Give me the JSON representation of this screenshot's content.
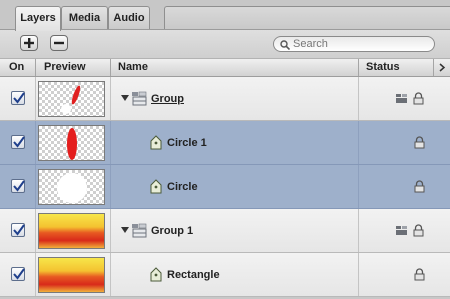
{
  "tabs": [
    "Layers",
    "Media",
    "Audio"
  ],
  "toolbar": {
    "add_icon": "plus-icon",
    "remove_icon": "minus-icon",
    "search_placeholder": "Search"
  },
  "columns": {
    "on": "On",
    "preview": "Preview",
    "name": "Name",
    "status": "Status"
  },
  "rows": [
    {
      "name": "Group",
      "kind": "group",
      "checked": true,
      "selected": false,
      "expanded": true,
      "preview": "group-shapes",
      "status_icons": [
        "group-status-icon",
        "lock-icon"
      ]
    },
    {
      "name": "Circle 1",
      "kind": "layer",
      "checked": true,
      "selected": true,
      "preview": "red-ellipse",
      "status_icons": [
        "lock-icon"
      ]
    },
    {
      "name": "Circle",
      "kind": "layer",
      "checked": true,
      "selected": true,
      "preview": "white-circle",
      "status_icons": [
        "lock-icon"
      ]
    },
    {
      "name": "Group 1",
      "kind": "group",
      "checked": true,
      "selected": false,
      "expanded": true,
      "preview": "gradient-rectangle",
      "status_icons": [
        "group-status-icon",
        "lock-icon"
      ]
    },
    {
      "name": "Rectangle",
      "kind": "layer",
      "checked": true,
      "selected": false,
      "preview": "gradient-rectangle",
      "status_icons": [
        "lock-icon"
      ]
    }
  ]
}
